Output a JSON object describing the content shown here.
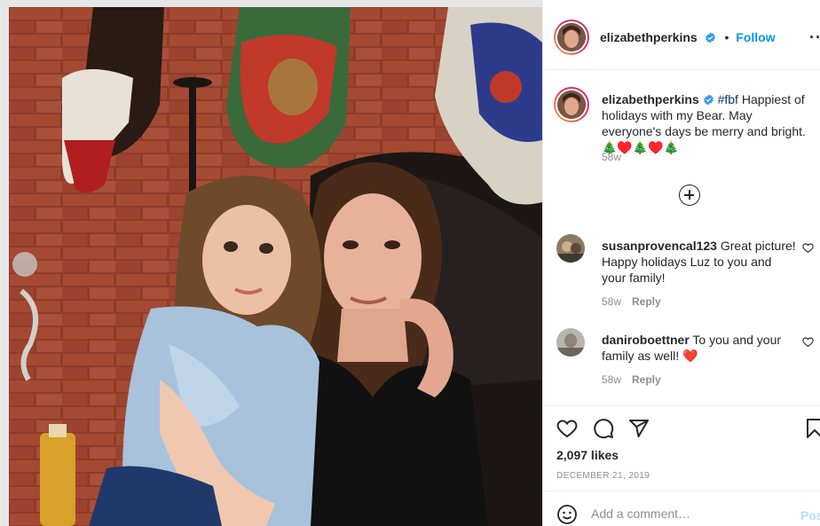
{
  "post": {
    "author": "elizabethperkins",
    "follow_label": "Follow",
    "separator": "•",
    "more_label": "···",
    "caption": {
      "hashtag": "#fbf",
      "text": " Happiest of holidays with my Bear. May everyone's days be merry and bright. 🎄♥️🎄♥️🎄",
      "time": "58w"
    },
    "likes": "2,097 likes",
    "date": "DECEMBER 21, 2019"
  },
  "comments": [
    {
      "user": "susanprovencal123",
      "text": " Great picture! Happy holidays Luz to you and your family!",
      "time": "58w",
      "reply_label": "Reply"
    },
    {
      "user": "daniroboettner",
      "text": " To you and your family as well! ❤️",
      "time": "58w",
      "reply_label": "Reply"
    }
  ],
  "add_comment": {
    "placeholder": "Add a comment…",
    "post_label": "Post"
  },
  "icons": {
    "verified": "verified-badge-icon",
    "more": "more-options-icon",
    "load_more": "load-more-comments-icon",
    "like": "heart-icon",
    "comment": "comment-bubble-icon",
    "share": "paper-plane-icon",
    "save": "bookmark-icon",
    "emoji": "smiley-face-icon"
  },
  "colors": {
    "accent": "#0095f6",
    "verified": "#3897f0",
    "hashtag": "#00376b",
    "muted": "#8e8e8e",
    "heart_emoji": "#ed4956"
  }
}
